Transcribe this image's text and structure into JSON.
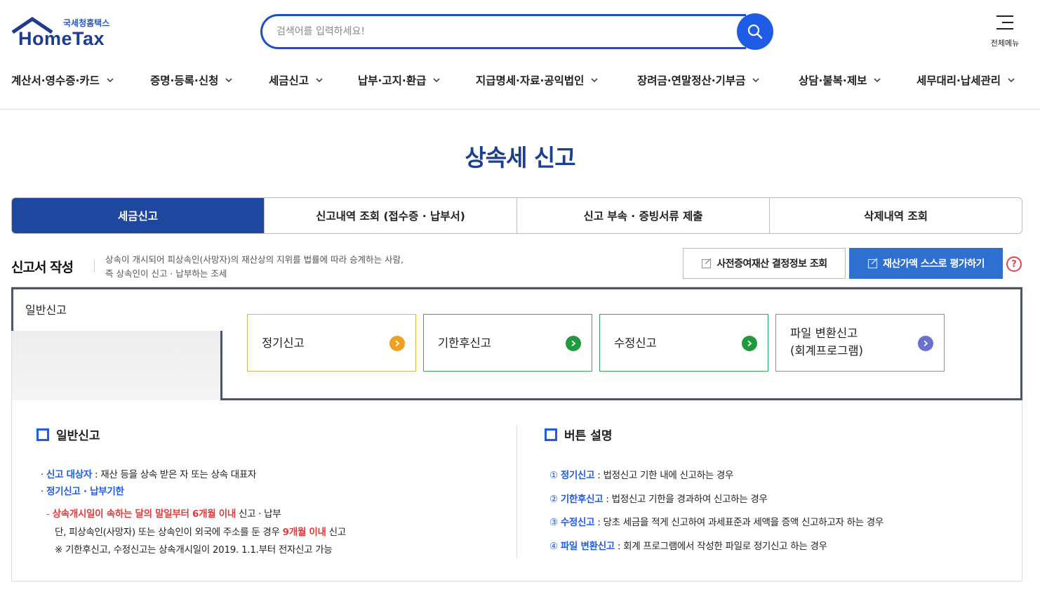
{
  "header": {
    "logo_small": "국세청홈택스",
    "logo_big": "HomeTax",
    "search_placeholder": "검색어를 입력하세요!",
    "all_menu_label": "전체메뉴"
  },
  "gnb": [
    "계산서·영수증·카드",
    "증명·등록·신청",
    "세금신고",
    "납부·고지·환급",
    "지급명세·자료·공익법인",
    "장려금·연말정산·기부금",
    "상담·불복·제보",
    "세무대리·납세관리"
  ],
  "page_title": "상속세 신고",
  "tabs": [
    "세금신고",
    "신고내역 조회 (접수증 · 납부서)",
    "신고 부속 · 증빙서류 제출",
    "삭제내역 조회"
  ],
  "section": {
    "title": "신고서 작성",
    "desc_line1": "상속이 개시되어 피상속인(사망자)의 재산상의 지위를 법률에 따라 승계하는 사람,",
    "desc_line2": "즉 상속인이 신고 · 납부하는 조세",
    "btn_prior_gift": "사전증여재산 결정정보 조회",
    "btn_self_eval": "재산가액 스스로 평가하기",
    "help": "?"
  },
  "filing": {
    "category": "일반신고",
    "buttons": [
      {
        "line1": "정기신고",
        "line2": "",
        "color": "#f0a020",
        "border": "#e8b04a"
      },
      {
        "line1": "기한후신고",
        "line2": "",
        "color": "#1f9a3c",
        "border": "#3aa552"
      },
      {
        "line1": "수정신고",
        "line2": "",
        "color": "#1f9a3c",
        "border": "#3aa552"
      },
      {
        "line1": "파일 변환신고",
        "line2": "(회계프로그램)",
        "color": "#6a6fd0",
        "border": "#8a90a8"
      }
    ]
  },
  "left_info": {
    "heading": "일반신고",
    "target_label": "신고 대상자",
    "target_text": " : 재산 등을 상속 받은 자 또는 상속 대표자",
    "deadline_label": "정기신고 · 납부기한",
    "rule1_red": "상속개시일이 속하는 달의 말일부터 6개월 이내",
    "rule1_tail": " 신고 · 납부",
    "rule2_head": "단, 피상속인(사망자) 또는 상속인이 외국에 주소를 둔 경우 ",
    "rule2_red": "9개월 이내",
    "rule2_tail": " 신고",
    "note": "※ 기한후신고, 수정신고는 상속개시일이 2019. 1.1.부터 전자신고 가능"
  },
  "right_info": {
    "heading": "버튼 설명",
    "items": [
      {
        "num": "①",
        "label": "정기신고",
        "text": " : 법정신고 기한 내에 신고하는 경우"
      },
      {
        "num": "②",
        "label": "기한후신고",
        "text": " : 법정신고 기한을 경과하여 신고하는 경우"
      },
      {
        "num": "③",
        "label": "수정신고",
        "text": " : 당초 세금을 적게 신고하여 과세표준과 세액을 증액 신고하고자 하는 경우"
      },
      {
        "num": "④",
        "label": "파일 변환신고",
        "text": " : 회계 프로그램에서 작성한 파일로 정기신고 하는 경우"
      }
    ]
  },
  "colors": {
    "brand_blue": "#1e47a0",
    "accent_blue": "#1f5ce6",
    "title_navy": "#1d3f8f",
    "warning_red": "#e03a3a"
  }
}
